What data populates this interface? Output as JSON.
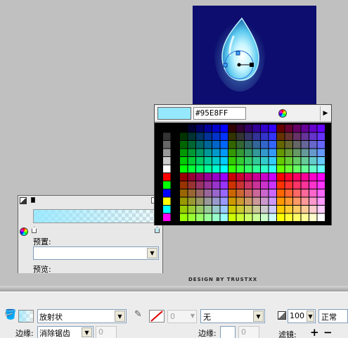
{
  "color_popup": {
    "hex_value": "#95E8FF",
    "current_color": "#95E8FF",
    "menu_arrow": "▶"
  },
  "gradient_panel": {
    "preset_label": "预置:",
    "preview_label": "预览:",
    "preset_value": ""
  },
  "credit": "DESIGN BY TRUSTXX",
  "properties": {
    "fill_type": "放射状",
    "stroke_style": "无",
    "stroke_width": "0",
    "opacity_value": "100",
    "blend_mode": "正常",
    "edge_label_left": "边缘:",
    "edge_value": "消除锯齿",
    "edge_amount": "0",
    "edge_label_right": "边缘:",
    "edge_amount_right": "0",
    "filters_label": "滤镜:",
    "add_filter": "+",
    "remove_filter": "−"
  },
  "icons": {
    "fill": "paint-bucket-icon",
    "stroke": "pencil-icon",
    "opacity": "opacity-icon",
    "wheel": "color-wheel-icon"
  }
}
